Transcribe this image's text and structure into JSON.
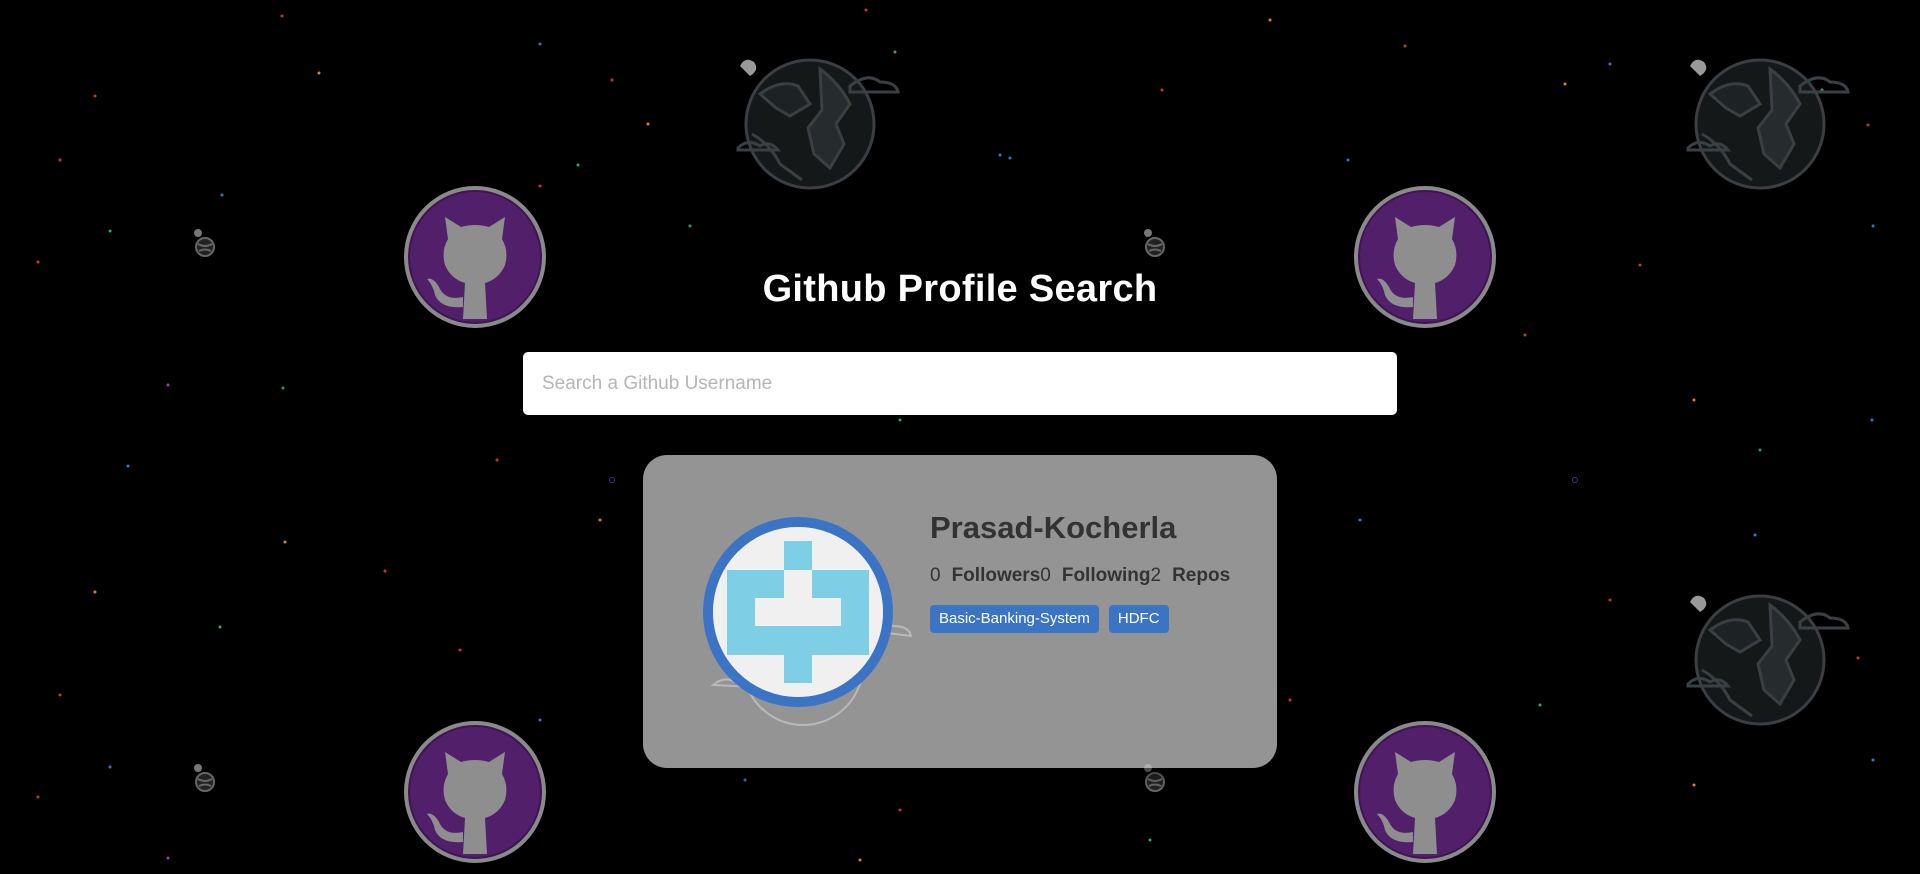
{
  "app": {
    "title": "Github Profile Search"
  },
  "search": {
    "placeholder": "Search a Github Username",
    "value": ""
  },
  "profile": {
    "username": "Prasad-Kocherla",
    "stats": [
      {
        "value": "0",
        "label": "Followers"
      },
      {
        "value": "0",
        "label": "Following"
      },
      {
        "value": "2",
        "label": "Repos"
      }
    ],
    "repos": [
      "Basic-Banking-System",
      "HDFC"
    ]
  },
  "colors": {
    "background": "#000000",
    "accent": "#3b74c4",
    "card": "#9c9c9c",
    "avatar_identicon": "#7ecfe6",
    "octocat_circle": "#4a1a5e"
  },
  "icons": {
    "background_pattern": [
      "octocat-icon",
      "globe-icon",
      "small-planet-icon"
    ],
    "avatar": "identicon"
  }
}
